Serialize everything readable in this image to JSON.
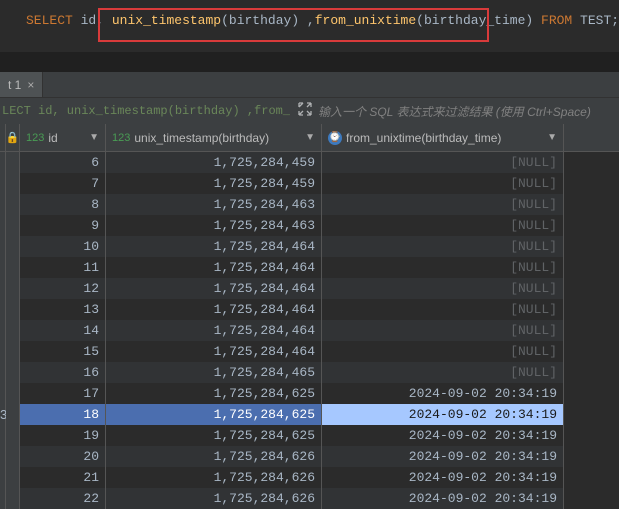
{
  "sql": {
    "keyword_select": "SELECT",
    "col_id": "id",
    "comma1": ",",
    "fn_unix": "unix_timestamp",
    "paren_open1": "(",
    "arg1": "birthday",
    "paren_close1": ")",
    "comma2": " ,",
    "fn_from": "from_unixtime",
    "paren_open2": "(",
    "arg2": "birthday_time",
    "paren_close2": ")",
    "keyword_from": "FROM",
    "table": "TEST",
    "semi": ";"
  },
  "tab": {
    "label": "t 1",
    "close": "×"
  },
  "filter": {
    "sql_text": "LECT id, unix_timestamp(birthday) ,from_unixtim",
    "hint": "输入一个 SQL 表达式来过滤结果 (使用 Ctrl+Space)"
  },
  "columns": {
    "id": {
      "badge": "123",
      "label": "id"
    },
    "ts": {
      "badge": "123",
      "label": "unix_timestamp(birthday)"
    },
    "ft": {
      "badge": "⏱",
      "label": "from_unixtime(birthday_time)"
    }
  },
  "rows": [
    {
      "n": "",
      "id": "6",
      "ts": "1,725,284,459",
      "ft": "[NULL]",
      "null": true
    },
    {
      "n": "",
      "id": "7",
      "ts": "1,725,284,459",
      "ft": "[NULL]",
      "null": true
    },
    {
      "n": "",
      "id": "8",
      "ts": "1,725,284,463",
      "ft": "[NULL]",
      "null": true
    },
    {
      "n": "",
      "id": "9",
      "ts": "1,725,284,463",
      "ft": "[NULL]",
      "null": true
    },
    {
      "n": "",
      "id": "10",
      "ts": "1,725,284,464",
      "ft": "[NULL]",
      "null": true
    },
    {
      "n": "",
      "id": "11",
      "ts": "1,725,284,464",
      "ft": "[NULL]",
      "null": true
    },
    {
      "n": "",
      "id": "12",
      "ts": "1,725,284,464",
      "ft": "[NULL]",
      "null": true
    },
    {
      "n": "",
      "id": "13",
      "ts": "1,725,284,464",
      "ft": "[NULL]",
      "null": true
    },
    {
      "n": "",
      "id": "14",
      "ts": "1,725,284,464",
      "ft": "[NULL]",
      "null": true
    },
    {
      "n": "",
      "id": "15",
      "ts": "1,725,284,464",
      "ft": "[NULL]",
      "null": true
    },
    {
      "n": "",
      "id": "16",
      "ts": "1,725,284,465",
      "ft": "[NULL]",
      "null": true
    },
    {
      "n": "",
      "id": "17",
      "ts": "1,725,284,625",
      "ft": "2024-09-02 20:34:19",
      "null": false
    },
    {
      "n": "3",
      "id": "18",
      "ts": "1,725,284,625",
      "ft": "2024-09-02 20:34:19",
      "null": false,
      "selected": true
    },
    {
      "n": "",
      "id": "19",
      "ts": "1,725,284,625",
      "ft": "2024-09-02 20:34:19",
      "null": false
    },
    {
      "n": "",
      "id": "20",
      "ts": "1,725,284,626",
      "ft": "2024-09-02 20:34:19",
      "null": false
    },
    {
      "n": "",
      "id": "21",
      "ts": "1,725,284,626",
      "ft": "2024-09-02 20:34:19",
      "null": false
    },
    {
      "n": "",
      "id": "22",
      "ts": "1,725,284,626",
      "ft": "2024-09-02 20:34:19",
      "null": false
    }
  ]
}
